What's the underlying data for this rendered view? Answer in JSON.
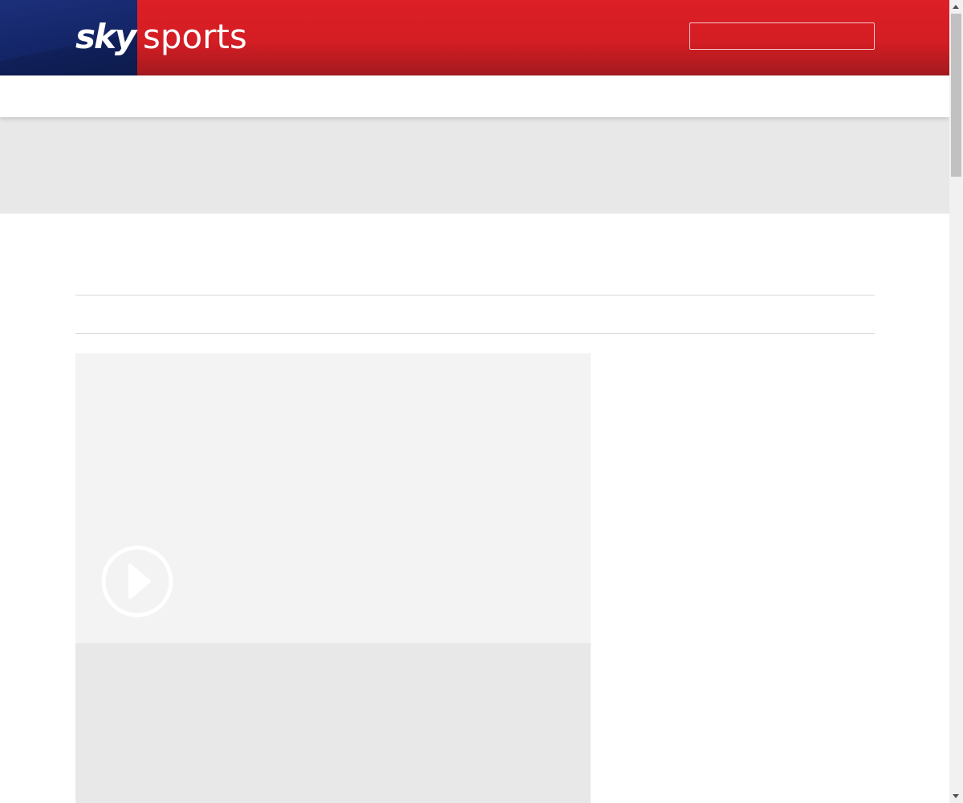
{
  "brand": {
    "logo_sky": "sky",
    "logo_sports": "sports",
    "primary_red": "#dd1f26",
    "primary_blue": "#15276b"
  },
  "header": {
    "search": {
      "value": "",
      "placeholder": ""
    }
  },
  "video": {
    "play_icon": "play-circle-icon"
  }
}
